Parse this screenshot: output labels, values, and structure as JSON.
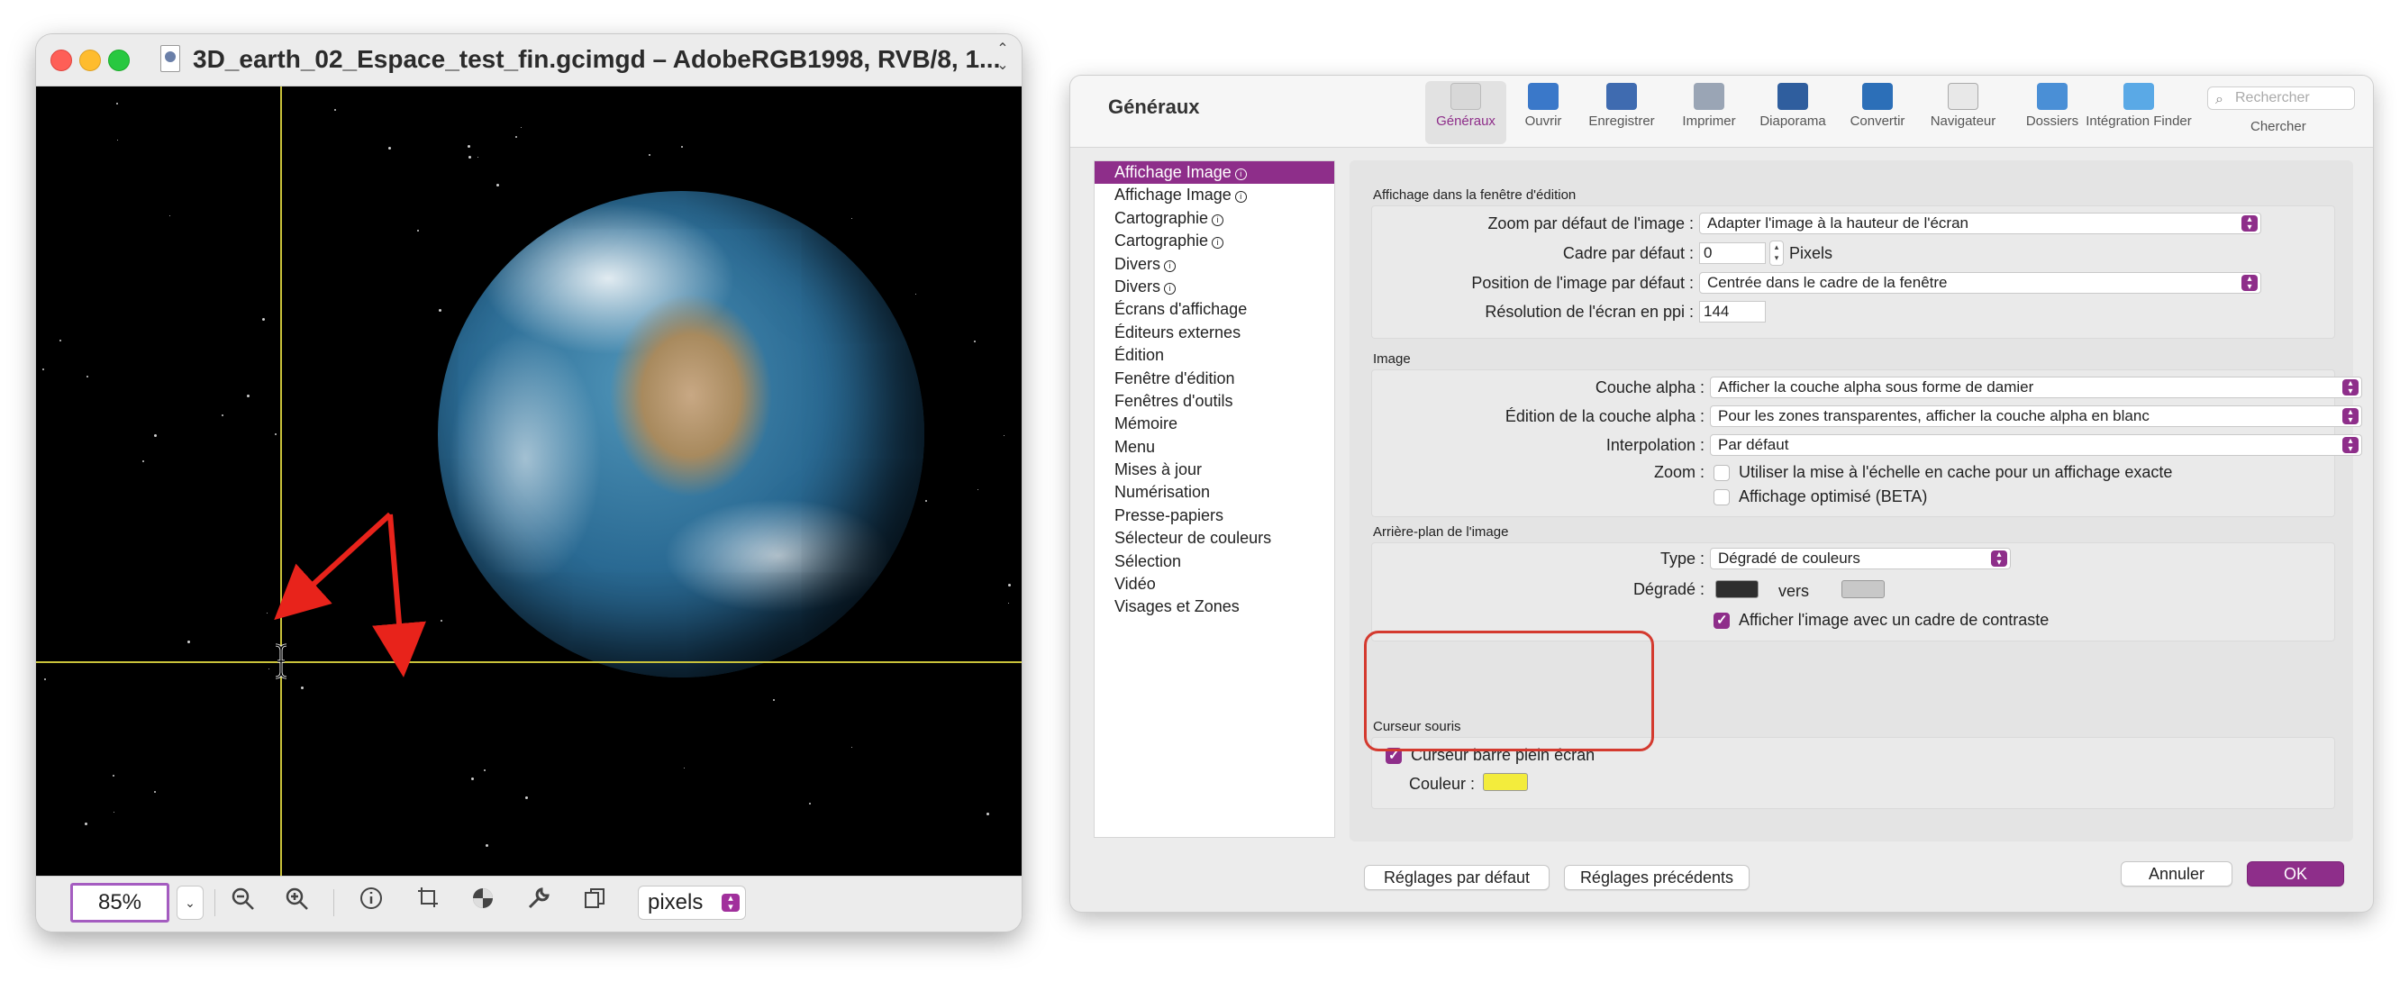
{
  "image_window": {
    "title": "3D_earth_02_Espace_test_fin.gcimgd – AdobeRGB1998, RVB/8, 1...",
    "zoom_value": "85%",
    "unit_value": "pixels",
    "colors": {
      "crosshair": "#c9c23a",
      "arrow": "#e8231b",
      "accent": "#a1309c"
    },
    "icons": [
      "zoom-out-icon",
      "zoom-in-icon",
      "info-icon",
      "crop-icon",
      "color-wheel-icon",
      "wrench-icon",
      "copy-icon"
    ]
  },
  "prefs": {
    "header_title": "Généraux",
    "toolbar": [
      {
        "label": "Généraux",
        "icon": "general-icon",
        "active": true
      },
      {
        "label": "Ouvrir",
        "icon": "open-icon"
      },
      {
        "label": "Enregistrer",
        "icon": "save-icon"
      },
      {
        "label": "Imprimer",
        "icon": "print-icon"
      },
      {
        "label": "Diaporama",
        "icon": "slideshow-icon"
      },
      {
        "label": "Convertir",
        "icon": "convert-icon"
      },
      {
        "label": "Navigateur",
        "icon": "browser-icon"
      },
      {
        "label": "Dossiers",
        "icon": "folders-icon"
      },
      {
        "label": "Intégration Finder",
        "icon": "finder-icon"
      }
    ],
    "search": {
      "placeholder": "Rechercher",
      "label": "Chercher"
    },
    "sidebar": [
      {
        "label": "Affichage Image",
        "sym": "ⓘ",
        "selected": true
      },
      {
        "label": "Affichage Image",
        "sym": "ⓘ"
      },
      {
        "label": "Cartographie",
        "sym": "ⓘ"
      },
      {
        "label": "Cartographie",
        "sym": "ⓘ"
      },
      {
        "label": "Divers",
        "sym": "ⓘ"
      },
      {
        "label": "Divers",
        "sym": "ⓘ"
      },
      {
        "label": "Écrans d'affichage"
      },
      {
        "label": "Éditeurs externes"
      },
      {
        "label": "Édition"
      },
      {
        "label": "Fenêtre d'édition"
      },
      {
        "label": "Fenêtres d'outils"
      },
      {
        "label": "Mémoire"
      },
      {
        "label": "Menu"
      },
      {
        "label": "Mises à jour"
      },
      {
        "label": "Numérisation"
      },
      {
        "label": "Presse-papiers"
      },
      {
        "label": "Sélecteur de couleurs"
      },
      {
        "label": "Sélection"
      },
      {
        "label": "Vidéo"
      },
      {
        "label": "Visages et Zones"
      }
    ],
    "sec_edit": {
      "title": "Affichage dans la fenêtre d'édition",
      "zoom_label": "Zoom par défaut de l'image :",
      "zoom_value": "Adapter l'image à la hauteur de l'écran",
      "frame_label": "Cadre par défaut :",
      "frame_value": "0",
      "frame_unit": "Pixels",
      "position_label": "Position de l'image par défaut :",
      "position_value": "Centrée dans le cadre de la fenêtre",
      "resolution_label": "Résolution de l'écran en ppi :",
      "resolution_value": "144"
    },
    "sec_image": {
      "title": "Image",
      "alpha_label": "Couche alpha :",
      "alpha_value": "Afficher la couche alpha sous forme de damier",
      "alpha_edit_label": "Édition de la couche alpha :",
      "alpha_edit_value": "Pour les zones transparentes, afficher la couche alpha en blanc",
      "interp_label": "Interpolation :",
      "interp_value": "Par défaut",
      "zoom_label": "Zoom :",
      "zoom_opt1": "Utiliser la mise à l'échelle en cache pour un affichage exacte",
      "zoom_opt2": "Affichage optimisé (BETA)"
    },
    "sec_bg": {
      "title": "Arrière-plan de l'image",
      "type_label": "Type :",
      "type_value": "Dégradé de couleurs",
      "gradient_label": "Dégradé :",
      "gradient_from": "#2e2e2e",
      "gradient_to": "#c8c8c8",
      "gradient_vers": "vers",
      "contrast_label": "Afficher l'image avec un cadre de contraste"
    },
    "sec_cursor": {
      "title": "Curseur souris",
      "fullscreen_label": "Curseur barre plein écran",
      "color_label": "Couleur :",
      "color": "#f3ec3c"
    },
    "buttons": {
      "defaults": "Réglages par défaut",
      "previous": "Réglages précédents",
      "cancel": "Annuler",
      "ok": "OK"
    }
  }
}
